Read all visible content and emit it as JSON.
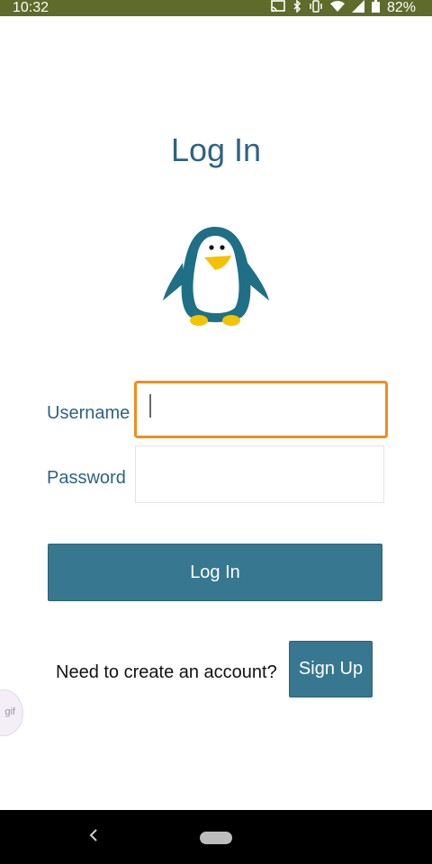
{
  "status_bar": {
    "time": "10:32",
    "battery_percent": "82%",
    "icons": [
      "cast-icon",
      "bluetooth-icon",
      "vibrate-icon",
      "wifi-icon",
      "signal-icon",
      "battery-icon"
    ]
  },
  "screen": {
    "title": "Log In"
  },
  "form": {
    "username_label": "Username",
    "username_value": "",
    "password_label": "Password",
    "password_value": "",
    "login_button": "Log In"
  },
  "signup": {
    "prompt": "Need to create an account?",
    "button": "Sign Up"
  },
  "floating_bubble": {
    "label": "gif"
  },
  "colors": {
    "accent": "#37778f",
    "title": "#2e6381",
    "focus": "#f28c1b",
    "status_bar": "#5e6b2a"
  }
}
